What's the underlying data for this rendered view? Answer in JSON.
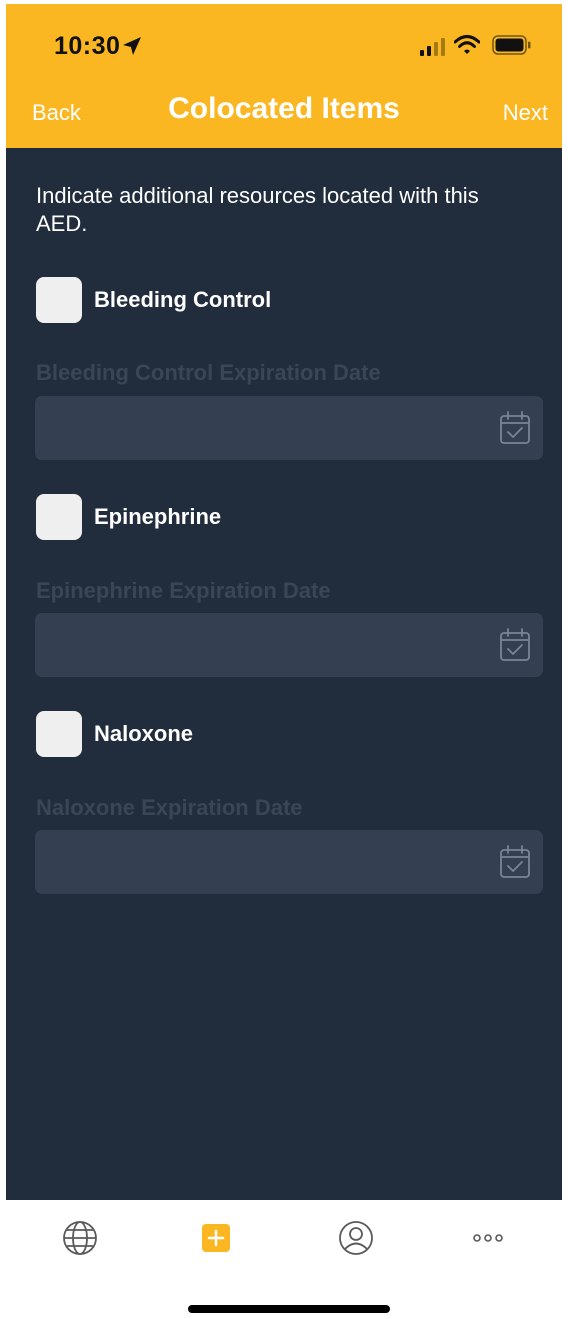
{
  "status_bar": {
    "time": "10:30"
  },
  "nav": {
    "back_label": "Back",
    "title": "Colocated Items",
    "next_label": "Next"
  },
  "intro_text": "Indicate additional resources located with this AED.",
  "items": [
    {
      "label": "Bleeding Control",
      "checked": false,
      "date_label": "Bleeding Control Expiration Date",
      "date_value": ""
    },
    {
      "label": "Epinephrine",
      "checked": false,
      "date_label": "Epinephrine Expiration Date",
      "date_value": ""
    },
    {
      "label": "Naloxone",
      "checked": false,
      "date_label": "Naloxone Expiration Date",
      "date_value": ""
    }
  ],
  "tabs": [
    {
      "icon": "globe-icon"
    },
    {
      "icon": "add-icon"
    },
    {
      "icon": "profile-icon"
    },
    {
      "icon": "more-icon"
    }
  ],
  "colors": {
    "header": "#FBB722",
    "background": "#212C3C",
    "field": "#344052",
    "accent": "#FBB722",
    "tab_icon": "#5A5A5A"
  }
}
